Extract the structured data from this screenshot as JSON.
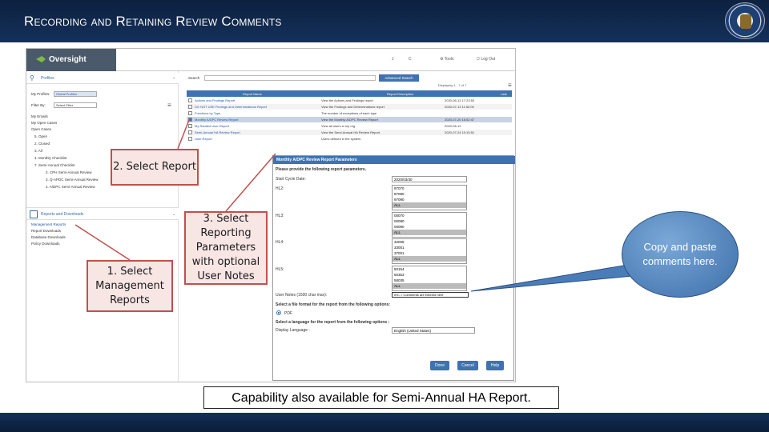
{
  "slide": {
    "title": "Recording and Retaining Review Comments"
  },
  "app": {
    "logo": "Oversight",
    "header_items": [
      "J",
      "C",
      "Tools",
      "Log Out"
    ]
  },
  "sidebar": {
    "profiles_label": "Profiles",
    "my_profiles_label": "My Profiles:",
    "my_profiles_value": "Global Profiles",
    "filter_label": "Filter By:",
    "filter_value": "Select Filter",
    "items": [
      "My Emails",
      "My Open Cases",
      "Open Cases",
      "5. Open",
      "2. Closed",
      "3. All",
      "4. Monthly Checklist",
      "7. Semi-Annual Checklist",
      "2. CPH Semi-Annual Review",
      "3. Q-APDC Semi-Annual Review",
      "4. A/DPC Semi-Annual Review"
    ],
    "reports_label": "Reports and Downloads",
    "report_items": [
      "Management Reports",
      "Report Downloads",
      "Database Downloads",
      "Policy Downloads"
    ]
  },
  "main": {
    "search_label": "Search",
    "advanced_search": "Advanced Search",
    "pager": "Displaying 1 - 7 of 7",
    "columns": [
      "Report Name",
      "Report Description",
      "Last"
    ],
    "rows": [
      [
        "Actions and Findings Report",
        "View the Actions and Findings report",
        "2020-06-12 17:23:53"
      ],
      [
        "DO NOT USE Findings and Determinations Report",
        "View the Findings and Determinations report",
        "2020-07-13 11:52:00"
      ],
      [
        "Functions by Type",
        "The number of exceptions of each type",
        ""
      ],
      [
        "Monthly A/DPC Review Report",
        "View the Monthly A/DPC Review Report",
        "2020-07-20 15:52:47"
      ],
      [
        "My Related User Report",
        "View all users in my org",
        "2020-06-12"
      ],
      [
        "Semi-Annual HA Review Report",
        "View the Semi-Annual HA Review Report",
        "2020-07-24 10:15:51"
      ],
      [
        "User Report",
        "Users defined in the system.",
        ""
      ]
    ]
  },
  "dialog": {
    "title": "Monthly A/DPC Review Report Parameters",
    "prompt": "Please provide the following report parameters.",
    "cycle_label": "Start Cycle Date:",
    "cycle_value": "2020/03/30",
    "hl2_label": "HL2:",
    "hl3_label": "HL3:",
    "hl4_label": "HL4:",
    "hl5_label": "HL5:",
    "hl2": [
      "97070",
      "97080",
      "97090",
      "ALL"
    ],
    "hl3": [
      "00070",
      "00080",
      "00090",
      "ALL"
    ],
    "hl4": [
      "32008",
      "33001",
      "37001",
      "ALL"
    ],
    "hl5": [
      "50154",
      "50353",
      "58035",
      "ALL"
    ],
    "notes_label": "User Notes (1500 char max):",
    "notes_value": "IHC = Comments are entered here",
    "format_prompt": "Select a file format for the report from the following options:",
    "format_option": "PDF",
    "lang_prompt": "Select a language for the report from the following options :",
    "lang_label": "Display Language :",
    "lang_value": "English (United States)",
    "buttons": [
      "Done",
      "Cancel",
      "Help"
    ]
  },
  "callouts": {
    "step1": "1. Select Management Reports",
    "step2": "2. Select Report",
    "step3": "3. Select Reporting Parameters with optional User Notes",
    "bubble": "Copy and paste comments here.",
    "caption": "Capability also available for Semi-Annual HA Report."
  },
  "colors": {
    "accent": "#3e72b0",
    "callout_border": "#c0504d",
    "callout_fill": "#f8e6e5",
    "topbar": "#0d2140"
  }
}
